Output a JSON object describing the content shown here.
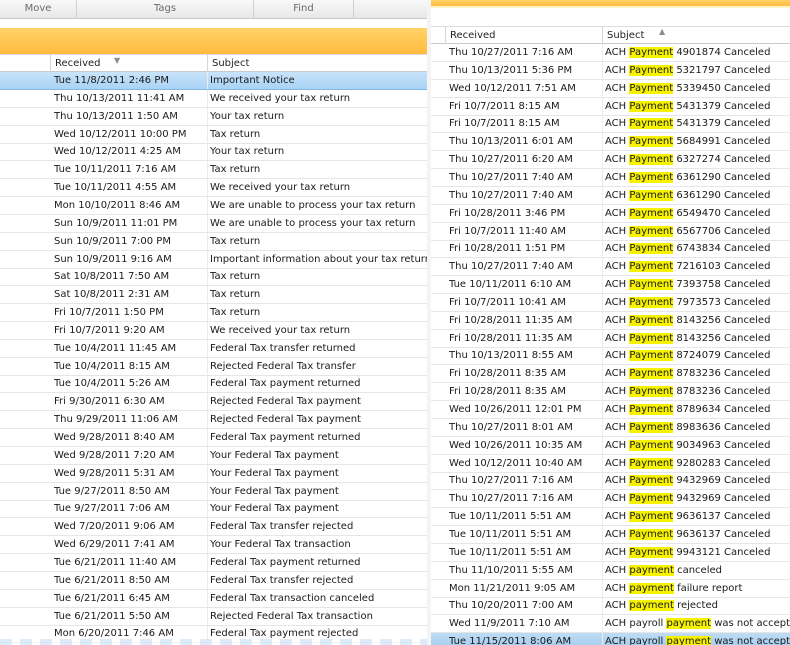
{
  "left_pane": {
    "toolbar_tabs": [
      "Move",
      "Tags",
      "Find"
    ],
    "columns": {
      "received": "Received",
      "subject": "Subject"
    },
    "emails": [
      {
        "received": "Tue 11/8/2011 2:46 PM",
        "subject": "Important Notice",
        "selected": true
      },
      {
        "received": "Thu 10/13/2011 11:41 AM",
        "subject": "We received your tax return"
      },
      {
        "received": "Thu 10/13/2011 1:50 AM",
        "subject": "Your tax return"
      },
      {
        "received": "Wed 10/12/2011 10:00 PM",
        "subject": "Tax return"
      },
      {
        "received": "Wed 10/12/2011 4:25 AM",
        "subject": "Your tax return"
      },
      {
        "received": "Tue 10/11/2011 7:16 AM",
        "subject": "Tax return"
      },
      {
        "received": "Tue 10/11/2011 4:55 AM",
        "subject": "We received your tax return"
      },
      {
        "received": "Mon 10/10/2011 8:46 AM",
        "subject": "We are unable to process your tax return"
      },
      {
        "received": "Sun 10/9/2011 11:01 PM",
        "subject": "We are unable to process your tax return"
      },
      {
        "received": "Sun 10/9/2011 7:00 PM",
        "subject": "Tax return"
      },
      {
        "received": "Sun 10/9/2011 9:16 AM",
        "subject": "Important information about your tax return"
      },
      {
        "received": "Sat 10/8/2011 7:50 AM",
        "subject": "Tax return"
      },
      {
        "received": "Sat 10/8/2011 2:31 AM",
        "subject": "Tax return"
      },
      {
        "received": "Fri 10/7/2011 1:50 PM",
        "subject": "Tax return"
      },
      {
        "received": "Fri 10/7/2011 9:20 AM",
        "subject": "We received your tax return"
      },
      {
        "received": "Tue 10/4/2011 11:45 AM",
        "subject": "Federal Tax transfer returned"
      },
      {
        "received": "Tue 10/4/2011 8:15 AM",
        "subject": "Rejected Federal Tax transfer"
      },
      {
        "received": "Tue 10/4/2011 5:26 AM",
        "subject": "Federal Tax payment returned"
      },
      {
        "received": "Fri 9/30/2011 6:30 AM",
        "subject": "Rejected Federal Tax payment"
      },
      {
        "received": "Thu 9/29/2011 11:06 AM",
        "subject": "Rejected Federal Tax payment"
      },
      {
        "received": "Wed 9/28/2011 8:40 AM",
        "subject": "Federal Tax payment returned"
      },
      {
        "received": "Wed 9/28/2011 7:20 AM",
        "subject": "Your Federal Tax payment"
      },
      {
        "received": "Wed 9/28/2011 5:31 AM",
        "subject": "Your Federal Tax payment"
      },
      {
        "received": "Tue 9/27/2011 8:50 AM",
        "subject": "Your Federal Tax payment"
      },
      {
        "received": "Tue 9/27/2011 7:06 AM",
        "subject": "Your Federal Tax payment"
      },
      {
        "received": "Wed 7/20/2011 9:06 AM",
        "subject": "Federal Tax transfer rejected"
      },
      {
        "received": "Wed 6/29/2011 7:41 AM",
        "subject": "Your Federal Tax transaction"
      },
      {
        "received": "Tue 6/21/2011 11:40 AM",
        "subject": "Federal Tax payment returned"
      },
      {
        "received": "Tue 6/21/2011 8:50 AM",
        "subject": "Federal Tax transfer rejected"
      },
      {
        "received": "Tue 6/21/2011 6:45 AM",
        "subject": "Federal Tax transaction canceled"
      },
      {
        "received": "Tue 6/21/2011 5:50 AM",
        "subject": "Rejected Federal Tax transaction"
      },
      {
        "received": "Mon 6/20/2011 7:46 AM",
        "subject": "Federal Tax payment rejected"
      }
    ]
  },
  "right_pane": {
    "columns": {
      "received": "Received",
      "subject": "Subject"
    },
    "emails": [
      {
        "received": "Thu 10/27/2011 7:16 AM",
        "pre": "ACH ",
        "hl": "Payment",
        "post": " 4901874 Canceled"
      },
      {
        "received": "Thu 10/13/2011 5:36 PM",
        "pre": "ACH ",
        "hl": "Payment",
        "post": " 5321797 Canceled"
      },
      {
        "received": "Wed 10/12/2011 7:51 AM",
        "pre": "ACH ",
        "hl": "Payment",
        "post": " 5339450 Canceled"
      },
      {
        "received": "Fri 10/7/2011 8:15 AM",
        "pre": "ACH ",
        "hl": "Payment",
        "post": " 5431379 Canceled"
      },
      {
        "received": "Fri 10/7/2011 8:15 AM",
        "pre": "ACH ",
        "hl": "Payment",
        "post": " 5431379 Canceled"
      },
      {
        "received": "Thu 10/13/2011 6:01 AM",
        "pre": "ACH ",
        "hl": "Payment",
        "post": " 5684991 Canceled"
      },
      {
        "received": "Thu 10/27/2011 6:20 AM",
        "pre": "ACH ",
        "hl": "Payment",
        "post": " 6327274 Canceled"
      },
      {
        "received": "Thu 10/27/2011 7:40 AM",
        "pre": "ACH ",
        "hl": "Payment",
        "post": " 6361290 Canceled"
      },
      {
        "received": "Thu 10/27/2011 7:40 AM",
        "pre": "ACH ",
        "hl": "Payment",
        "post": " 6361290 Canceled"
      },
      {
        "received": "Fri 10/28/2011 3:46 PM",
        "pre": "ACH ",
        "hl": "Payment",
        "post": " 6549470 Canceled"
      },
      {
        "received": "Fri 10/7/2011 11:40 AM",
        "pre": "ACH ",
        "hl": "Payment",
        "post": " 6567706 Canceled"
      },
      {
        "received": "Fri 10/28/2011 1:51 PM",
        "pre": "ACH ",
        "hl": "Payment",
        "post": " 6743834 Canceled"
      },
      {
        "received": "Thu 10/27/2011 7:40 AM",
        "pre": "ACH ",
        "hl": "Payment",
        "post": " 7216103 Canceled"
      },
      {
        "received": "Tue 10/11/2011 6:10 AM",
        "pre": "ACH ",
        "hl": "Payment",
        "post": " 7393758 Canceled"
      },
      {
        "received": "Fri 10/7/2011 10:41 AM",
        "pre": "ACH ",
        "hl": "Payment",
        "post": " 7973573 Canceled"
      },
      {
        "received": "Fri 10/28/2011 11:35 AM",
        "pre": "ACH ",
        "hl": "Payment",
        "post": " 8143256 Canceled"
      },
      {
        "received": "Fri 10/28/2011 11:35 AM",
        "pre": "ACH ",
        "hl": "Payment",
        "post": " 8143256 Canceled"
      },
      {
        "received": "Thu 10/13/2011 8:55 AM",
        "pre": "ACH ",
        "hl": "Payment",
        "post": " 8724079 Canceled"
      },
      {
        "received": "Fri 10/28/2011 8:35 AM",
        "pre": "ACH ",
        "hl": "Payment",
        "post": " 8783236 Canceled"
      },
      {
        "received": "Fri 10/28/2011 8:35 AM",
        "pre": "ACH ",
        "hl": "Payment",
        "post": " 8783236 Canceled"
      },
      {
        "received": "Wed 10/26/2011 12:01 PM",
        "pre": "ACH ",
        "hl": "Payment",
        "post": " 8789634 Canceled"
      },
      {
        "received": "Thu 10/27/2011 8:01 AM",
        "pre": "ACH ",
        "hl": "Payment",
        "post": " 8983636 Canceled"
      },
      {
        "received": "Wed 10/26/2011 10:35 AM",
        "pre": "ACH ",
        "hl": "Payment",
        "post": " 9034963 Canceled"
      },
      {
        "received": "Wed 10/12/2011 10:40 AM",
        "pre": "ACH ",
        "hl": "Payment",
        "post": " 9280283 Canceled"
      },
      {
        "received": "Thu 10/27/2011 7:16 AM",
        "pre": "ACH ",
        "hl": "Payment",
        "post": " 9432969 Canceled"
      },
      {
        "received": "Thu 10/27/2011 7:16 AM",
        "pre": "ACH ",
        "hl": "Payment",
        "post": " 9432969 Canceled"
      },
      {
        "received": "Tue 10/11/2011 5:51 AM",
        "pre": "ACH ",
        "hl": "Payment",
        "post": " 9636137 Canceled"
      },
      {
        "received": "Tue 10/11/2011 5:51 AM",
        "pre": "ACH ",
        "hl": "Payment",
        "post": " 9636137 Canceled"
      },
      {
        "received": "Tue 10/11/2011 5:51 AM",
        "pre": "ACH ",
        "hl": "Payment",
        "post": " 9943121 Canceled"
      },
      {
        "received": "Thu 11/10/2011 5:55 AM",
        "pre": "ACH ",
        "hl": "payment",
        "post": " canceled"
      },
      {
        "received": "Mon 11/21/2011 9:05 AM",
        "pre": "ACH ",
        "hl": "payment",
        "post": " failure report"
      },
      {
        "received": "Thu 10/20/2011 7:00 AM",
        "pre": "ACH ",
        "hl": "payment",
        "post": " rejected"
      },
      {
        "received": "Wed 11/9/2011 7:10 AM",
        "pre": "ACH payroll ",
        "hl": "payment",
        "post": " was not accepted"
      },
      {
        "received": "Tue 11/15/2011 8:06 AM",
        "pre": "ACH payroll ",
        "hl": "payment",
        "post": " was not accepted",
        "selected": true
      }
    ]
  },
  "colors": {
    "ribbon_orange": "#ffbb3e",
    "selection_blue": "#a9d3f5",
    "search_highlight": "#f7f200"
  }
}
